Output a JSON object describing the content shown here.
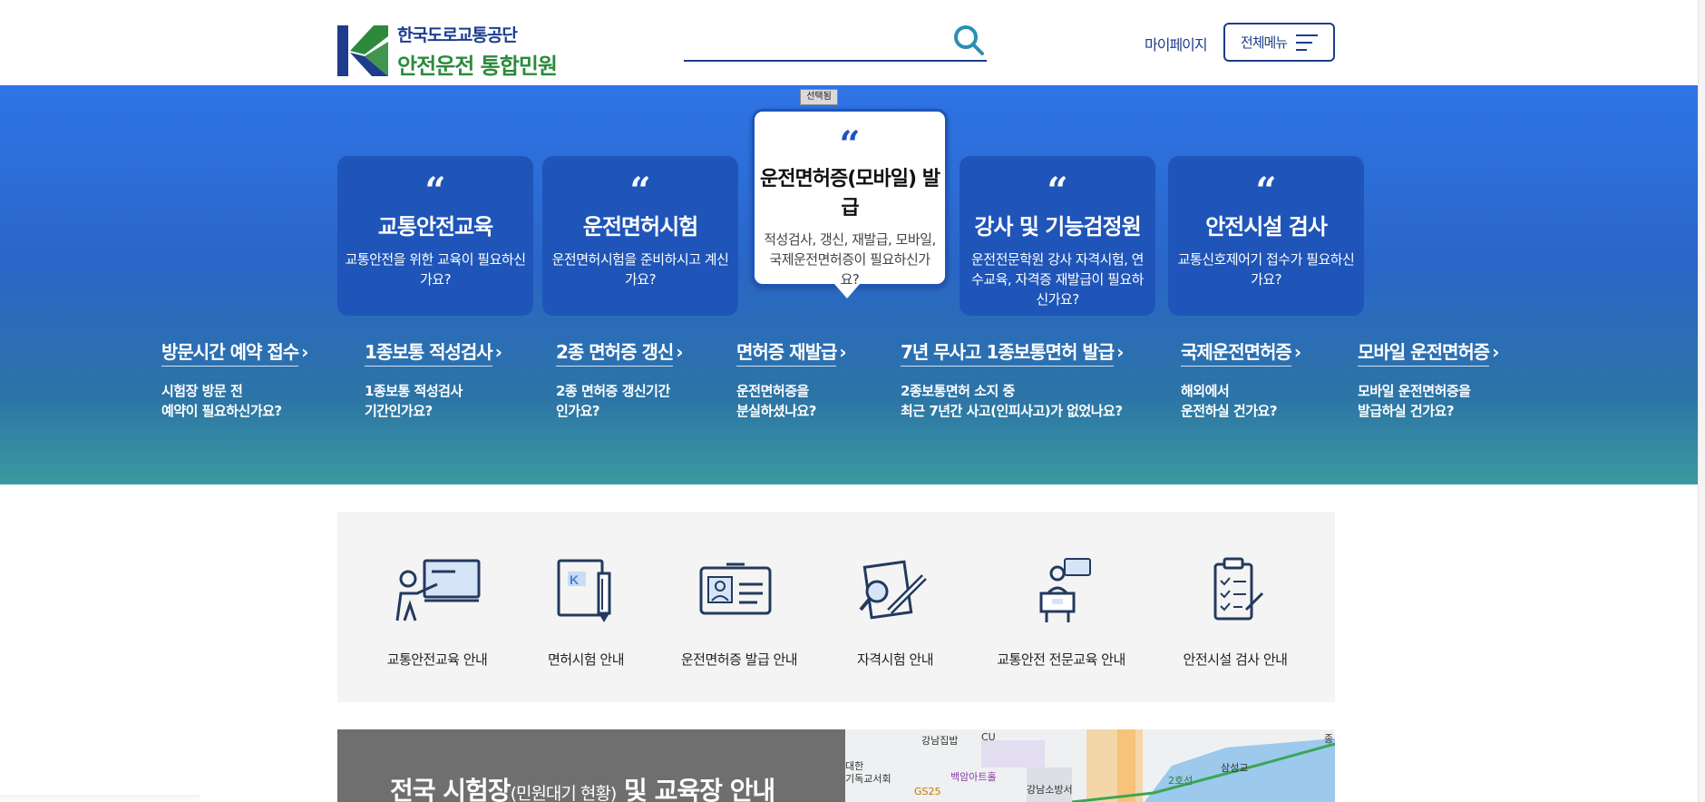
{
  "header": {
    "logo_line1": "한국도로교통공단",
    "logo_line2": "안전운전 통합민원",
    "search_placeholder": "",
    "mypage_label": "마이페이지",
    "allmenu_label": "전체메뉴"
  },
  "hero": {
    "selected_tag": "선택됨",
    "cards": [
      {
        "quote": "“",
        "title": "교통안전교육",
        "desc": "교통안전을 위한 교육이 필요하신가요?"
      },
      {
        "quote": "“",
        "title": "운전면허시험",
        "desc": "운전면허시험을 준비하시고 계신가요?"
      },
      {
        "quote": "“",
        "title": "운전면허증(모바일) 발급",
        "desc": "적성검사, 갱신, 재발급, 모바일, 국제운전면허증이 필요하신가요?"
      },
      {
        "quote": "“",
        "title": "강사 및 기능검정원",
        "desc": "운전전문학원 강사 자격시험, 연수교육, 자격증 재발급이 필요하신가요?"
      },
      {
        "quote": "“",
        "title": "안전시설 검사",
        "desc": "교통신호제어기 접수가 필요하신가요?"
      }
    ],
    "quick_links": [
      {
        "title": "방문시간 예약 접수",
        "arrow": "›",
        "desc1": "시험장 방문 전",
        "desc2": "예약이 필요하신가요?"
      },
      {
        "title": "1종보통 적성검사",
        "arrow": "›",
        "desc1": "1종보통 적성검사",
        "desc2": "기간인가요?"
      },
      {
        "title": "2종 면허증 갱신",
        "arrow": "›",
        "desc1": "2종 면허증 갱신기간",
        "desc2": "인가요?"
      },
      {
        "title": "면허증 재발급",
        "arrow": "›",
        "desc1": "운전면허증을",
        "desc2": "분실하셨나요?"
      },
      {
        "title": "7년 무사고 1종보통면허 발급",
        "arrow": "›",
        "desc1": "2종보통면허 소지 중",
        "desc2": "최근 7년간 사고(인피사고)가 없었나요?"
      },
      {
        "title": "국제운전면허증",
        "arrow": "›",
        "desc1": "해외에서",
        "desc2": "운전하실 건가요?"
      },
      {
        "title": "모바일 운전면허증",
        "arrow": "›",
        "desc1": "모바일 운전면허증을",
        "desc2": "발급하실 건가요?"
      }
    ]
  },
  "guide": {
    "items": [
      {
        "label": "교통안전교육 안내",
        "icon": "presentation-icon"
      },
      {
        "label": "면허시험 안내",
        "icon": "exam-document-icon"
      },
      {
        "label": "운전면허증 발급 안내",
        "icon": "id-card-icon"
      },
      {
        "label": "자격시험 안내",
        "icon": "certificate-pen-icon"
      },
      {
        "label": "교통안전 전문교육 안내",
        "icon": "lecturer-icon"
      },
      {
        "label": "안전시설 검사 안내",
        "icon": "checklist-clipboard-icon"
      }
    ]
  },
  "lower": {
    "title_main1": "전국 시험장",
    "title_small": "(민원대기 현황)",
    "title_main2": " 및 교육장 안내"
  },
  "map": {
    "labels": [
      "강남집밥",
      "CU",
      "대한",
      "기독교서회",
      "백암아트홀",
      "GS25",
      "강남소방서",
      "삼성교",
      "2호선",
      "종"
    ]
  },
  "colors": {
    "brand_navy": "#1d3c8a",
    "brand_green": "#2d8a3d",
    "card_blue": "#1f55b8",
    "hero_top": "#2f74e6",
    "hero_bottom": "#3a9aa0"
  }
}
